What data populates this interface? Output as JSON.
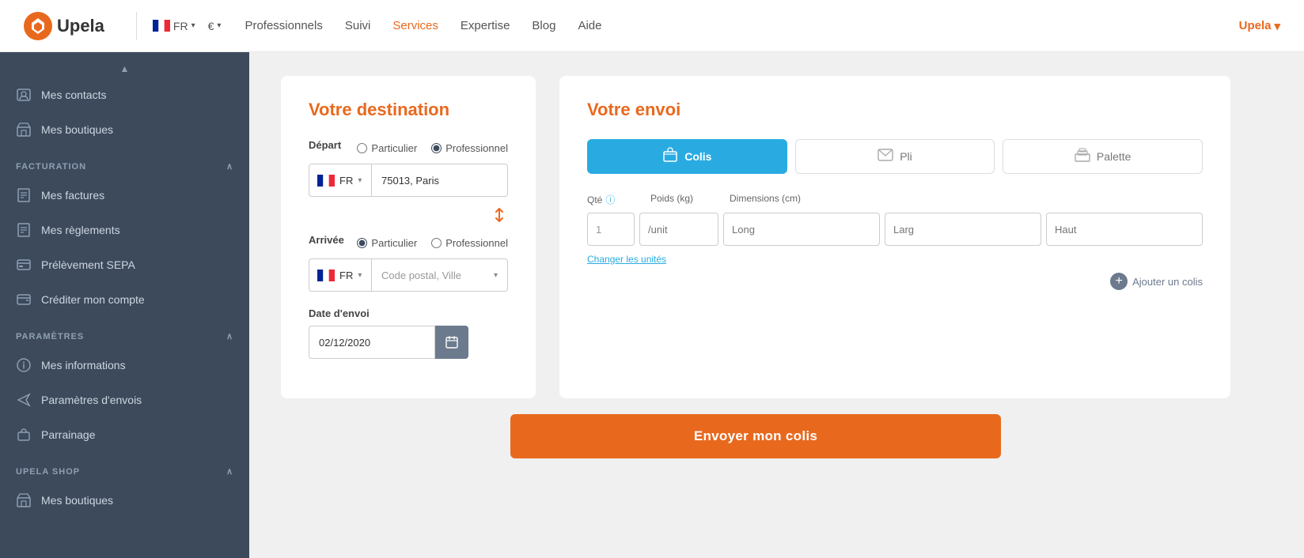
{
  "topnav": {
    "logo_text": "Upela",
    "lang": "FR",
    "currency": "€",
    "links": [
      {
        "label": "Professionnels",
        "active": false
      },
      {
        "label": "Suivi",
        "active": false
      },
      {
        "label": "Services",
        "active": true
      },
      {
        "label": "Expertise",
        "active": false
      },
      {
        "label": "Blog",
        "active": false
      },
      {
        "label": "Aide",
        "active": false
      }
    ],
    "user_label": "Upela"
  },
  "sidebar": {
    "sections": [
      {
        "items": [
          {
            "icon": "contacts-icon",
            "label": "Mes contacts"
          },
          {
            "icon": "boutiques-icon",
            "label": "Mes boutiques"
          }
        ]
      },
      {
        "title": "FACTURATION",
        "collapsible": true,
        "items": [
          {
            "icon": "factures-icon",
            "label": "Mes factures"
          },
          {
            "icon": "reglements-icon",
            "label": "Mes règlements"
          },
          {
            "icon": "sepa-icon",
            "label": "Prélèvement SEPA"
          },
          {
            "icon": "credit-icon",
            "label": "Créditer mon compte"
          }
        ]
      },
      {
        "title": "PARAMÈTRES",
        "collapsible": true,
        "items": [
          {
            "icon": "info-icon",
            "label": "Mes informations"
          },
          {
            "icon": "envois-icon",
            "label": "Paramètres d'envois"
          },
          {
            "icon": "parrainage-icon",
            "label": "Parrainage"
          }
        ]
      },
      {
        "title": "UPELA SHOP",
        "collapsible": true,
        "items": [
          {
            "icon": "boutiques-icon",
            "label": "Mes boutiques"
          }
        ]
      }
    ]
  },
  "destination": {
    "title": "Votre destination",
    "depart_label": "Départ",
    "depart_country": "FR",
    "depart_city": "75013, Paris",
    "depart_type_options": [
      "Particulier",
      "Professionnel"
    ],
    "depart_type_selected": "Professionnel",
    "arrivee_label": "Arrivée",
    "arrivee_country": "FR",
    "arrivee_city_placeholder": "Code postal, Ville",
    "arrivee_type_options": [
      "Particulier",
      "Professionnel"
    ],
    "arrivee_type_selected": "Particulier",
    "date_label": "Date d'envoi",
    "date_value": "02/12/2020"
  },
  "envoi": {
    "title": "Votre envoi",
    "tabs": [
      {
        "id": "colis",
        "label": "Colis",
        "active": true
      },
      {
        "id": "pli",
        "label": "Pli",
        "active": false
      },
      {
        "id": "palette",
        "label": "Palette",
        "active": false
      }
    ],
    "fields": {
      "qte_label": "Qté",
      "poids_label": "Poids (kg)",
      "dim_label": "Dimensions (cm)",
      "qte_value": "1",
      "poids_placeholder": "/unit",
      "long_placeholder": "Long",
      "larg_placeholder": "Larg",
      "haut_placeholder": "Haut"
    },
    "changer_unites": "Changer les unités",
    "ajouter_colis": "Ajouter un colis"
  },
  "cta": {
    "label": "Envoyer mon colis"
  }
}
